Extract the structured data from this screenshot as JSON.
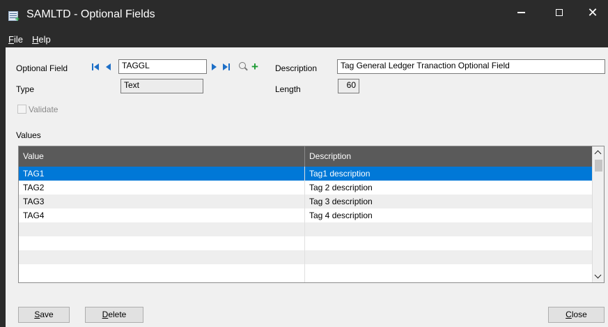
{
  "window": {
    "title": "SAMLTD - Optional Fields"
  },
  "menu": {
    "items": [
      {
        "label": "File",
        "mnemonic": "F",
        "rest": "ile"
      },
      {
        "label": "Help",
        "mnemonic": "H",
        "rest": "elp"
      }
    ]
  },
  "form": {
    "optional_field_label": "Optional Field",
    "optional_field_value": "TAGGL",
    "description_label": "Description",
    "description_value": "Tag General Ledger Tranaction Optional Field",
    "type_label": "Type",
    "type_value": "Text",
    "length_label": "Length",
    "length_value": "60",
    "validate_label": "Validate",
    "validate_checked": false,
    "values_label": "Values"
  },
  "grid": {
    "columns": [
      "Value",
      "Description"
    ],
    "rows": [
      {
        "value": "TAG1",
        "description": "Tag1 description",
        "selected": true
      },
      {
        "value": "TAG2",
        "description": "Tag 2 description",
        "selected": false
      },
      {
        "value": "TAG3",
        "description": "Tag 3 description",
        "selected": false
      },
      {
        "value": "TAG4",
        "description": "Tag 4 description",
        "selected": false
      }
    ]
  },
  "buttons": {
    "save": {
      "label": "Save",
      "mnemonic": "S",
      "rest": "ave"
    },
    "delete": {
      "label": "Delete",
      "mnemonic": "D",
      "rest": "elete"
    },
    "close": {
      "label": "Close",
      "mnemonic": "C",
      "rest": "lose"
    }
  },
  "icons": [
    "app-icon",
    "first-record-icon",
    "previous-record-icon",
    "next-record-icon",
    "last-record-icon",
    "search-icon",
    "add-icon"
  ],
  "colors": {
    "titlebar": "#2b2b2b",
    "selection": "#0078d7",
    "grid_header": "#5a5a5a",
    "nav_arrows": "#1d6fc7",
    "add_icon": "#1c9b33"
  }
}
